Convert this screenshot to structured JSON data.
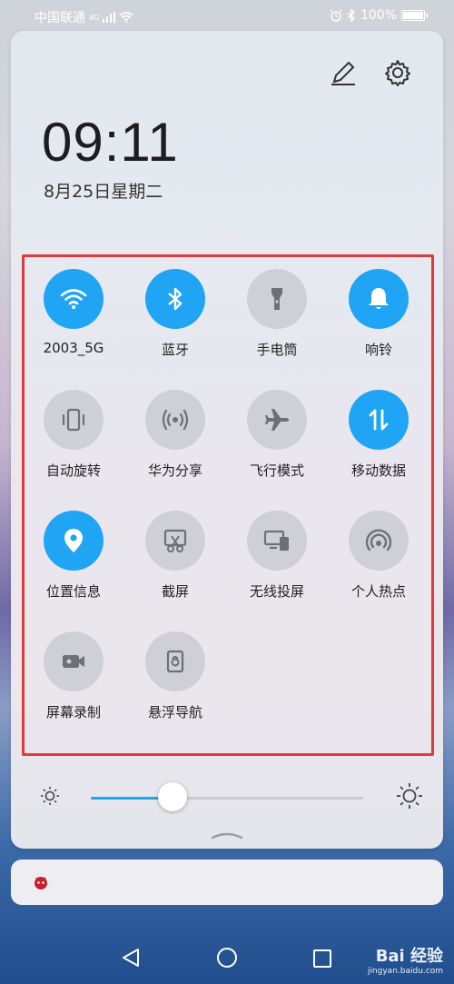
{
  "status": {
    "carrier": "中国联通",
    "network": "4G",
    "battery": "100%"
  },
  "clock": {
    "time": "09:11",
    "date": "8月25日星期二"
  },
  "tiles": [
    {
      "label": "2003_5G",
      "icon": "wifi-icon",
      "on": true
    },
    {
      "label": "蓝牙",
      "icon": "bluetooth-icon",
      "on": true
    },
    {
      "label": "手电筒",
      "icon": "flashlight-icon",
      "on": false
    },
    {
      "label": "响铃",
      "icon": "bell-icon",
      "on": true
    },
    {
      "label": "自动旋转",
      "icon": "rotate-icon",
      "on": false
    },
    {
      "label": "华为分享",
      "icon": "share-icon",
      "on": false
    },
    {
      "label": "飞行模式",
      "icon": "airplane-icon",
      "on": false
    },
    {
      "label": "移动数据",
      "icon": "mobile-data-icon",
      "on": true
    },
    {
      "label": "位置信息",
      "icon": "location-icon",
      "on": true
    },
    {
      "label": "截屏",
      "icon": "screenshot-icon",
      "on": false
    },
    {
      "label": "无线投屏",
      "icon": "cast-icon",
      "on": false
    },
    {
      "label": "个人热点",
      "icon": "hotspot-icon",
      "on": false
    },
    {
      "label": "屏幕录制",
      "icon": "screen-record-icon",
      "on": false
    },
    {
      "label": "悬浮导航",
      "icon": "float-nav-icon",
      "on": false
    }
  ],
  "brightness": {
    "level": 0.3
  },
  "colors": {
    "accent": "#1fa5f4",
    "tile_off": "#cfd0d6",
    "highlight": "#e23a3a"
  },
  "watermark": {
    "main": "Bai 经验",
    "sub": "jingyan.baidu.com"
  }
}
